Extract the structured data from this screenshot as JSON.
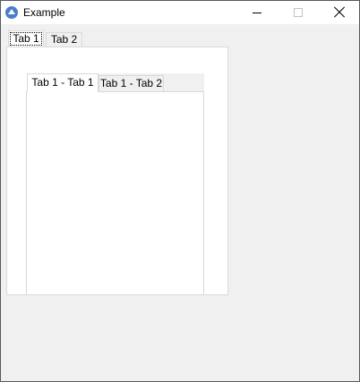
{
  "window": {
    "title": "Example",
    "app_icon": "app-icon",
    "controls": {
      "minimize_icon": "minimize-icon",
      "maximize_icon": "maximize-icon",
      "close_icon": "close-icon"
    }
  },
  "outer_tabs": {
    "selected": 0,
    "tabs": [
      {
        "label": "Tab 1"
      },
      {
        "label": "Tab 2"
      }
    ]
  },
  "inner_tabs": {
    "selected": 0,
    "tabs": [
      {
        "label": "Tab 1 - Tab 1"
      },
      {
        "label": "Tab 1 - Tab 2"
      }
    ]
  },
  "colors": {
    "window_background": "#f0f0f0",
    "titlebar_background": "#ffffff",
    "tab_border": "#d9d9d9",
    "icon_accent": "#4a7fc8"
  }
}
